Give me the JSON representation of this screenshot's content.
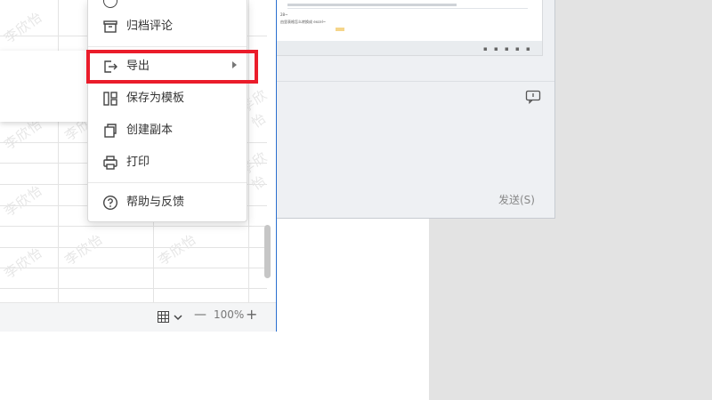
{
  "chat": {
    "send_label": "发送(S)",
    "thumb_line1": "28~",
    "thumb_line2": "由里表格怎么转换成 excel~"
  },
  "menu": {
    "items": [
      {
        "label": "归档评论",
        "icon": "archive-icon"
      },
      {
        "label": "导出",
        "icon": "export-icon",
        "has_submenu": true,
        "highlighted": true
      },
      {
        "label": "保存为模板",
        "icon": "template-icon"
      },
      {
        "label": "创建副本",
        "icon": "copy-icon"
      },
      {
        "label": "打印",
        "icon": "print-icon"
      },
      {
        "label": "帮助与反馈",
        "icon": "help-icon"
      }
    ]
  },
  "statusbar": {
    "zoom": "100%",
    "minus": "—",
    "plus": "+"
  },
  "watermark": "李欣怡",
  "colors": {
    "highlight": "#ea1c2a",
    "sheet_border": "#2a6fcf"
  }
}
